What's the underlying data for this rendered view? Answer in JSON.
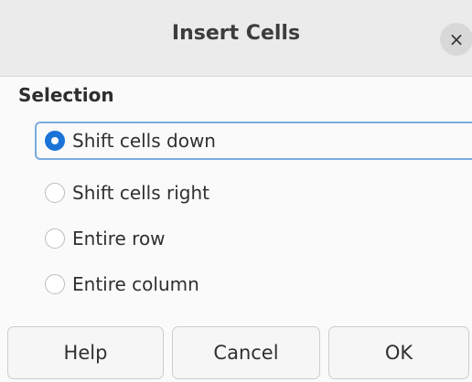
{
  "dialog": {
    "title": "Insert Cells",
    "close_glyph": "×"
  },
  "selection": {
    "label": "Selection",
    "options": [
      {
        "label": "Shift cells down",
        "checked": true
      },
      {
        "label": "Shift cells right",
        "checked": false
      },
      {
        "label": "Entire row",
        "checked": false
      },
      {
        "label": "Entire column",
        "checked": false
      }
    ]
  },
  "buttons": {
    "help": "Help",
    "cancel": "Cancel",
    "ok": "OK"
  },
  "colors": {
    "accent": "#1a74d8",
    "focus_ring": "#7aaae0"
  }
}
